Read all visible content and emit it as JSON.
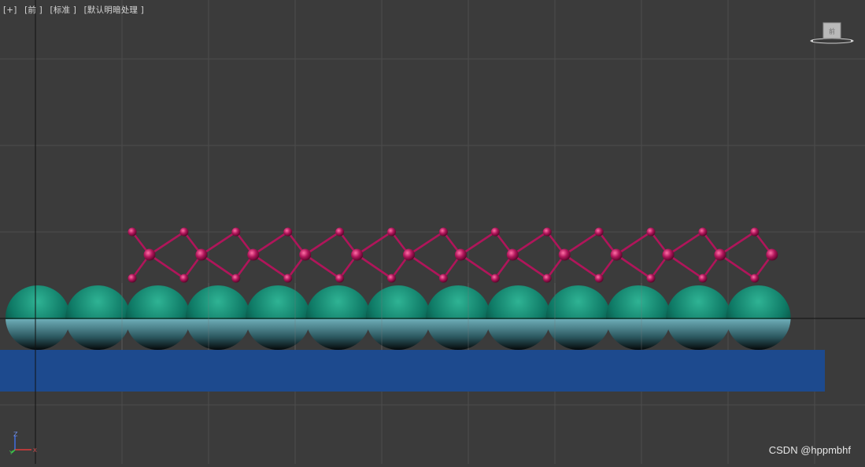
{
  "viewport": {
    "labels": [
      "[+]",
      "[前 ]",
      "[标准 ]",
      "[默认明暗处理 ]"
    ],
    "viewcube_face": "前"
  },
  "watermark": "CSDN @hppmbhf",
  "axis": {
    "z": "Z",
    "y": "Y",
    "x": "X"
  },
  "colors": {
    "background": "#3b3b3b",
    "grid": "#4c4c4c",
    "substrate": "#1d4a8e",
    "sphere_top": "#0f7a66",
    "sphere_bottom": "#8fd2dc",
    "molecule": "#b0155a"
  },
  "scene": {
    "sphere_count": 13,
    "molecule_unit_count": 13
  }
}
